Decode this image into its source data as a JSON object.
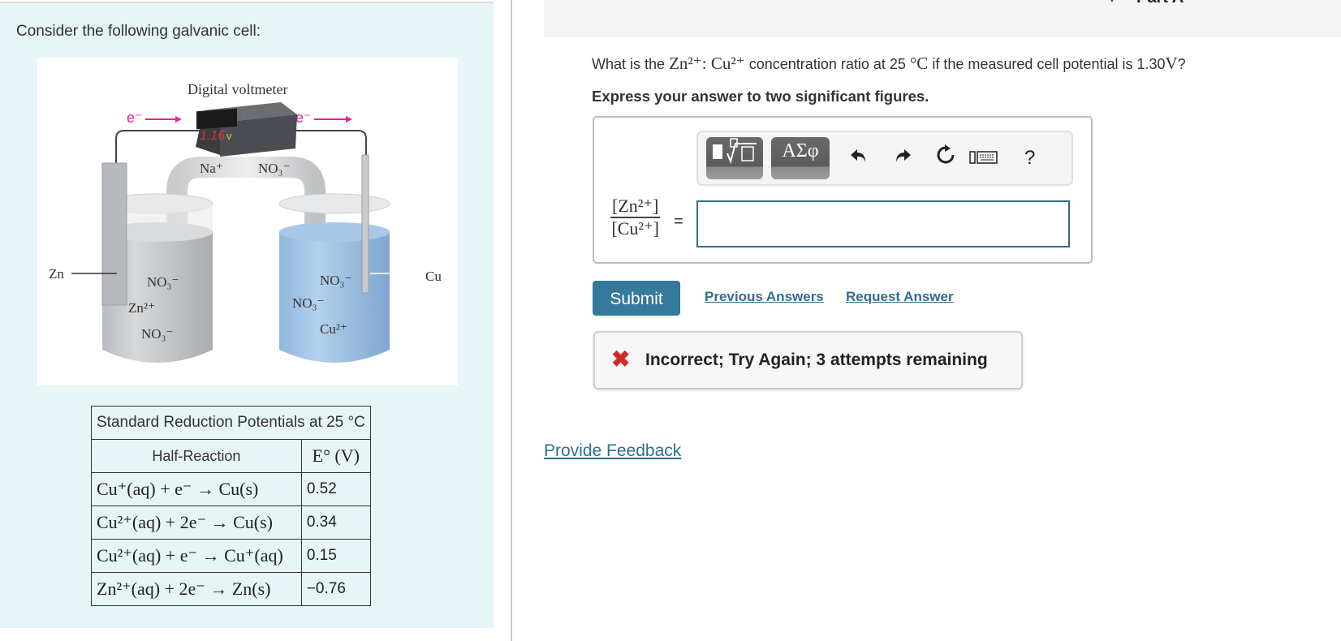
{
  "left_panel": {
    "intro": "Consider the following galvanic cell:",
    "diagram": {
      "title": "Digital voltmeter",
      "reading": "1.16",
      "reading_unit": "v",
      "electron_label": "e⁻",
      "salt_bridge": {
        "cation": "Na⁺",
        "anion": "NO₃⁻"
      },
      "left_electrode": "Zn",
      "right_electrode": "Cu",
      "left_ions": [
        "NO₃⁻",
        "Zn²⁺",
        "NO₃⁻"
      ],
      "right_ions": [
        "NO₃⁻",
        "NO₃⁻",
        "Cu²⁺"
      ]
    },
    "table": {
      "title": "Standard Reduction Potentials at 25 °C",
      "col_reaction": "Half-Reaction",
      "col_potential": "E° (V)",
      "rows": [
        {
          "reaction": "Cu⁺(aq) + e⁻ → Cu(s)",
          "potential": "0.52"
        },
        {
          "reaction": "Cu²⁺(aq) + 2e⁻ → Cu(s)",
          "potential": "0.34"
        },
        {
          "reaction": "Cu²⁺(aq) + e⁻ → Cu⁺(aq)",
          "potential": "0.15"
        },
        {
          "reaction": "Zn²⁺(aq) + 2e⁻ → Zn(s)",
          "potential": "−0.76"
        }
      ]
    }
  },
  "part": {
    "title": "Part A",
    "question_prefix": "What is the",
    "question_species": "Zn²⁺: Cu²⁺",
    "question_mid": "concentration ratio at 25",
    "question_temp": "°C",
    "question_mid2": "if the measured cell potential is 1.30",
    "question_unit": "V",
    "question_end": "?",
    "instruction": "Express your answer to two significant figures.",
    "toolbar": {
      "template_icon": "template-sqrt-icon",
      "greek_label": "ΑΣφ",
      "undo_icon": "undo-icon",
      "redo_icon": "redo-icon",
      "reset_icon": "reset-icon",
      "keyboard_icon": "keyboard-icon",
      "help_label": "?"
    },
    "fraction": {
      "numerator": "[Zn²⁺]",
      "denominator": "[Cu²⁺]",
      "equals": "="
    },
    "answer_value": "",
    "submit_label": "Submit",
    "previous_answers_label": "Previous Answers",
    "request_answer_label": "Request Answer",
    "feedback": {
      "icon": "✖",
      "text": "Incorrect; Try Again; 3 attempts remaining",
      "color": "#d12b2b"
    }
  },
  "provide_feedback_label": "Provide Feedback",
  "colors": {
    "accent": "#35799b",
    "link": "#2d6f93",
    "panel_bg": "#e6f5f5",
    "error": "#d12b2b"
  }
}
